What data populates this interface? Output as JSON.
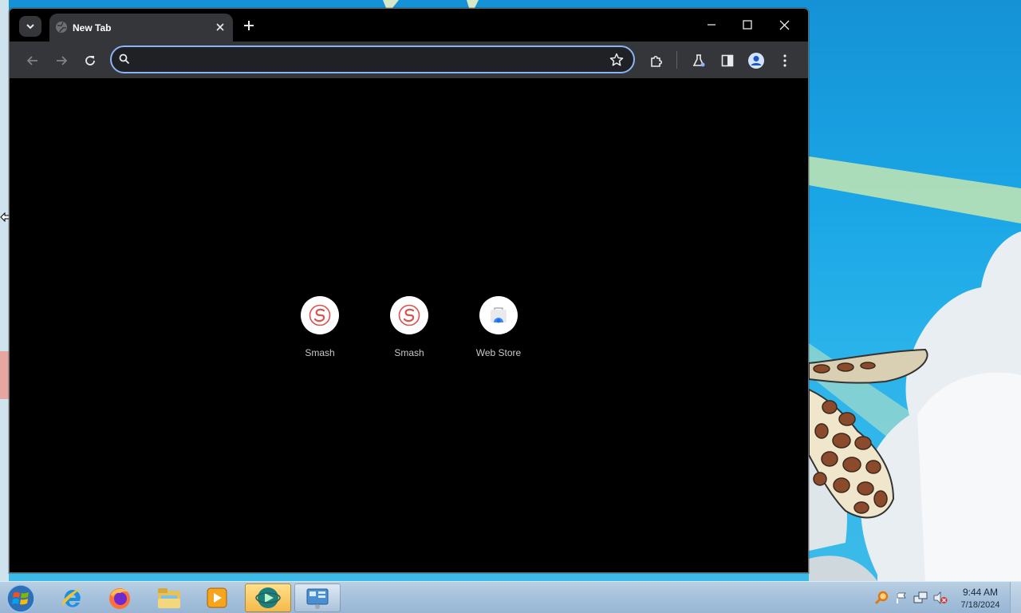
{
  "browser": {
    "tab": {
      "title": "New Tab",
      "favicon": "globe-icon"
    },
    "omnibox": {
      "value": "",
      "placeholder": ""
    },
    "window_controls": [
      "minimize-icon",
      "maximize-icon",
      "close-icon"
    ],
    "toolbar_icons": [
      "back-icon",
      "forward-icon",
      "reload-icon",
      "star-icon",
      "extensions-icon",
      "labs-icon",
      "side-panel-icon",
      "profile-icon",
      "menu-icon"
    ]
  },
  "shortcuts": [
    {
      "label": "Smash",
      "icon": "smash-icon",
      "color": "#d9534f"
    },
    {
      "label": "Smash",
      "icon": "smash-icon",
      "color": "#d9534f"
    },
    {
      "label": "Web Store",
      "icon": "web-store-icon",
      "color": "#4285f4"
    }
  ],
  "taskbar": {
    "apps": [
      "internet-explorer-icon",
      "firefox-icon",
      "file-explorer-icon",
      "media-player-icon",
      "active-app-icon",
      "control-panel-icon"
    ],
    "tray": [
      "search-tray-icon",
      "flag-icon",
      "network-icon",
      "volume-muted-icon"
    ],
    "clock": {
      "time": "9:44 AM",
      "date": "7/18/2024"
    }
  },
  "colors": {
    "accent": "#8ab4f8",
    "toolbar": "#35363a",
    "content_bg": "#000000"
  }
}
